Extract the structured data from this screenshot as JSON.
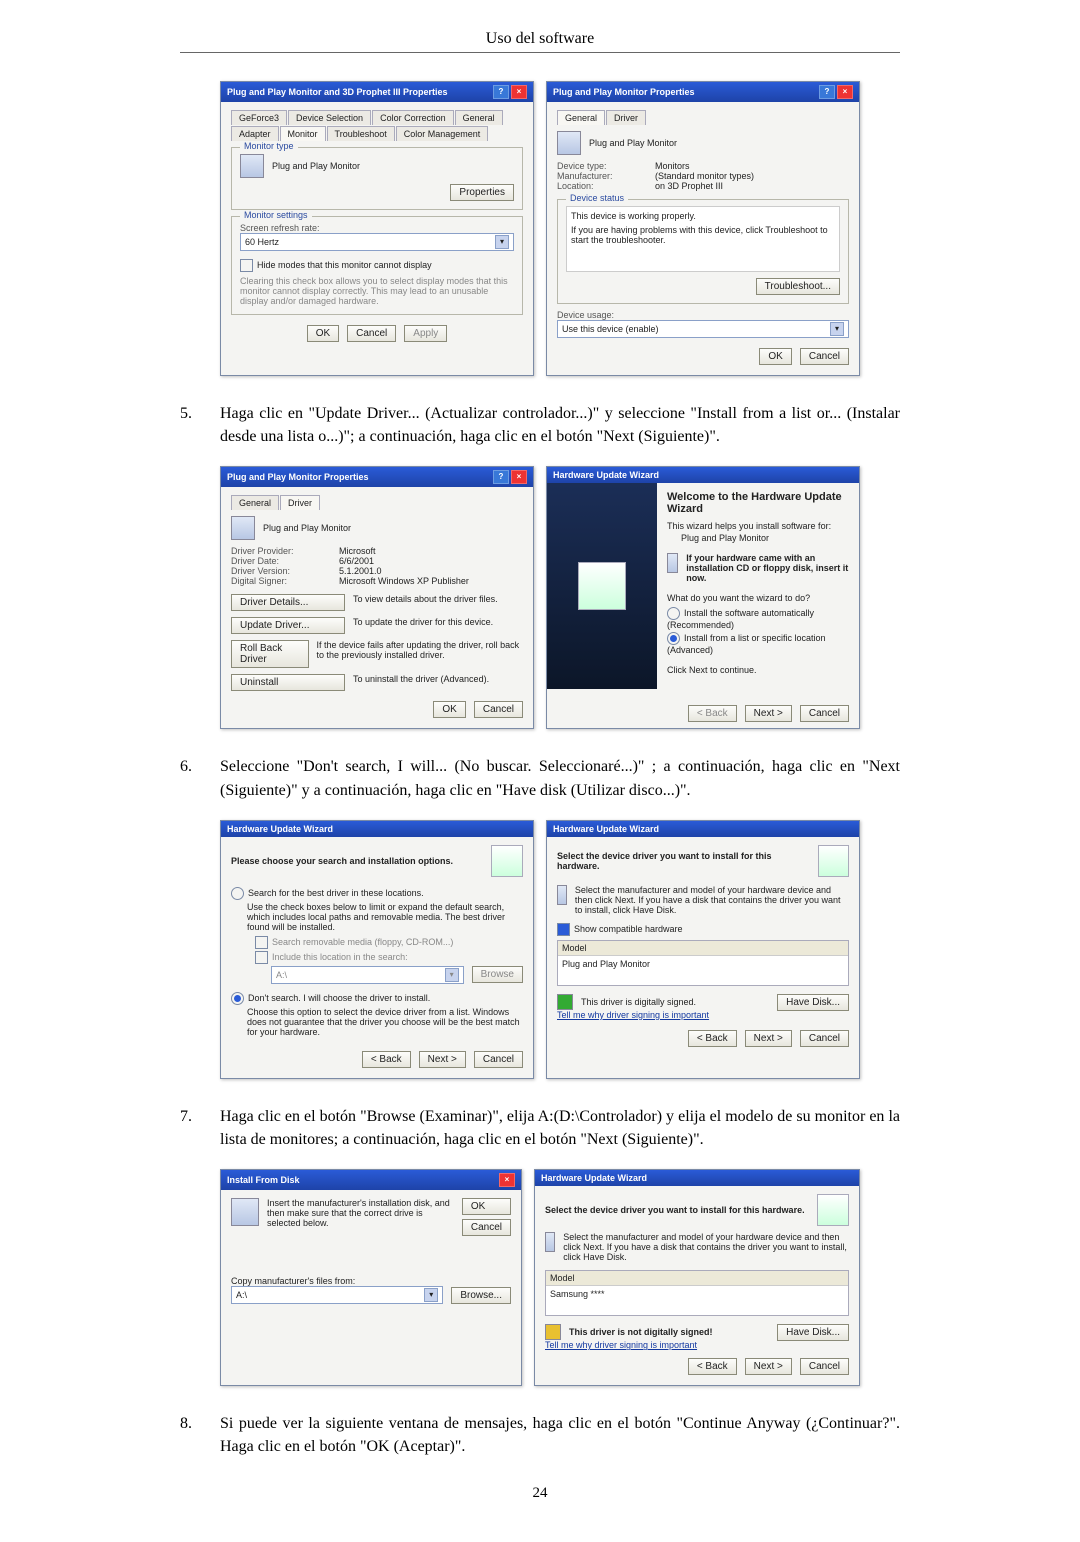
{
  "chapter_title": "Uso del software",
  "page_number": "24",
  "instructions": {
    "i5": {
      "num": "5.",
      "text": "Haga clic en \"Update Driver... (Actualizar controlador...)\" y seleccione \"Install from a list or... (Instalar desde una lista o...)\"; a continuación, haga clic en el botón \"Next (Siguiente)\"."
    },
    "i6": {
      "num": "6.",
      "text": "Seleccione \"Don't search, I will... (No buscar. Seleccionaré...)\" ; a continuación, haga clic en \"Next (Siguiente)\" y a continuación, haga clic en \"Have disk (Utilizar disco...)\"."
    },
    "i7": {
      "num": "7.",
      "text": "Haga clic en el botón \"Browse (Examinar)\", elija A:(D:\\Controlador) y elija el modelo de su monitor en la lista de monitores; a continuación, haga clic en el botón \"Next (Siguiente)\"."
    },
    "i8": {
      "num": "8.",
      "text": "Si puede ver la siguiente ventana de mensajes, haga clic en el botón \"Continue Anyway (¿Continuar?\". Haga clic en el botón \"OK (Aceptar)\"."
    }
  },
  "fig1": {
    "left": {
      "title": "Plug and Play Monitor and 3D Prophet III Properties",
      "tabs": [
        "GeForce3",
        "Device Selection",
        "Color Correction",
        "General",
        "Adapter",
        "Monitor",
        "Troubleshoot",
        "Color Management"
      ],
      "monitor_type_h": "Monitor type",
      "monitor_type_v": "Plug and Play Monitor",
      "properties_btn": "Properties",
      "monitor_settings_h": "Monitor settings",
      "refresh_lbl": "Screen refresh rate:",
      "refresh_val": "60 Hertz",
      "hide_modes": "Hide modes that this monitor cannot display",
      "hide_note": "Clearing this check box allows you to select display modes that this monitor cannot display correctly. This may lead to an unusable display and/or damaged hardware.",
      "ok": "OK",
      "cancel": "Cancel",
      "apply": "Apply"
    },
    "right": {
      "title": "Plug and Play Monitor Properties",
      "tabs": [
        "General",
        "Driver"
      ],
      "header": "Plug and Play Monitor",
      "dt_l": "Device type:",
      "dt_v": "Monitors",
      "mf_l": "Manufacturer:",
      "mf_v": "(Standard monitor types)",
      "lo_l": "Location:",
      "lo_v": "on 3D Prophet III",
      "status_h": "Device status",
      "status_1": "This device is working properly.",
      "status_2": "If you are having problems with this device, click Troubleshoot to start the troubleshooter.",
      "trouble_btn": "Troubleshoot...",
      "usage_l": "Device usage:",
      "usage_v": "Use this device (enable)",
      "ok": "OK",
      "cancel": "Cancel"
    }
  },
  "fig2": {
    "left": {
      "title": "Plug and Play Monitor Properties",
      "tabs": [
        "General",
        "Driver"
      ],
      "header": "Plug and Play Monitor",
      "prov_l": "Driver Provider:",
      "prov_v": "Microsoft",
      "date_l": "Driver Date:",
      "date_v": "6/6/2001",
      "ver_l": "Driver Version:",
      "ver_v": "5.1.2001.0",
      "sig_l": "Digital Signer:",
      "sig_v": "Microsoft Windows XP Publisher",
      "b1": "Driver Details...",
      "b1t": "To view details about the driver files.",
      "b2": "Update Driver...",
      "b2t": "To update the driver for this device.",
      "b3": "Roll Back Driver",
      "b3t": "If the device fails after updating the driver, roll back to the previously installed driver.",
      "b4": "Uninstall",
      "b4t": "To uninstall the driver (Advanced).",
      "ok": "OK",
      "cancel": "Cancel"
    },
    "right": {
      "title": "Hardware Update Wizard",
      "welcome": "Welcome to the Hardware Update Wizard",
      "helps": "This wizard helps you install software for:",
      "for": "Plug and Play Monitor",
      "cd_note": "If your hardware came with an installation CD or floppy disk, insert it now.",
      "q": "What do you want the wizard to do?",
      "o1": "Install the software automatically (Recommended)",
      "o2": "Install from a list or specific location (Advanced)",
      "cont": "Click Next to continue.",
      "back": "< Back",
      "next": "Next >",
      "cancel": "Cancel"
    }
  },
  "fig3": {
    "left": {
      "title": "Hardware Update Wizard",
      "header": "Please choose your search and installation options.",
      "o1": "Search for the best driver in these locations.",
      "o1n": "Use the check boxes below to limit or expand the default search, which includes local paths and removable media. The best driver found will be installed.",
      "c1": "Search removable media (floppy, CD-ROM...)",
      "c2": "Include this location in the search:",
      "path": "A:\\",
      "browse": "Browse",
      "o2": "Don't search. I will choose the driver to install.",
      "o2n": "Choose this option to select the device driver from a list. Windows does not guarantee that the driver you choose will be the best match for your hardware.",
      "back": "< Back",
      "next": "Next >",
      "cancel": "Cancel"
    },
    "right": {
      "title": "Hardware Update Wizard",
      "header": "Select the device driver you want to install for this hardware.",
      "sub": "Select the manufacturer and model of your hardware device and then click Next. If you have a disk that contains the driver you want to install, click Have Disk.",
      "show": "Show compatible hardware",
      "model_h": "Model",
      "model_v": "Plug and Play Monitor",
      "signed": "This driver is digitally signed.",
      "why": "Tell me why driver signing is important",
      "have": "Have Disk...",
      "back": "< Back",
      "next": "Next >",
      "cancel": "Cancel"
    }
  },
  "fig4": {
    "left": {
      "title": "Install From Disk",
      "msg": "Insert the manufacturer's installation disk, and then make sure that the correct drive is selected below.",
      "ok": "OK",
      "cancel": "Cancel",
      "copy_l": "Copy manufacturer's files from:",
      "path": "A:\\",
      "browse": "Browse..."
    },
    "right": {
      "title": "Hardware Update Wizard",
      "header": "Select the device driver you want to install for this hardware.",
      "sub": "Select the manufacturer and model of your hardware device and then click Next. If you have a disk that contains the driver you want to install, click Have Disk.",
      "model_h": "Model",
      "model_v": "Samsung ****",
      "signed": "This driver is not digitally signed!",
      "why": "Tell me why driver signing is important",
      "have": "Have Disk...",
      "back": "< Back",
      "next": "Next >",
      "cancel": "Cancel"
    }
  }
}
